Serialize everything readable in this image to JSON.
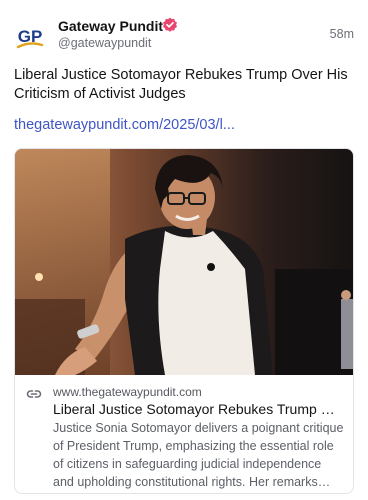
{
  "author": {
    "name": "Gateway Pundit",
    "handle": "@gatewaypundit",
    "avatar_initials": "GP",
    "verified_color": "#e8466e"
  },
  "post": {
    "time": "58m",
    "text": "Liberal Justice Sotomayor Rebukes Trump Over His Criticism of Activist Judges",
    "link": "thegatewaypundit.com/2025/03/l..."
  },
  "card": {
    "domain": "www.thegatewaypundit.com",
    "title": "Liberal Justice Sotomayor Rebukes Trump Ove...",
    "description": "Justice Sonia Sotomayor delivers a poignant critique of President Trump, emphasizing the essential role of citizens in safeguarding judicial independence and upholding constitutional rights. Her remarks resonate ...",
    "image_icon": "photo-of-speaker-on-stage",
    "link_icon": "chain-link-icon"
  },
  "colors": {
    "link": "#3f55c7",
    "logo_blue": "#1f3c8a",
    "logo_gold": "#e0a21a"
  }
}
